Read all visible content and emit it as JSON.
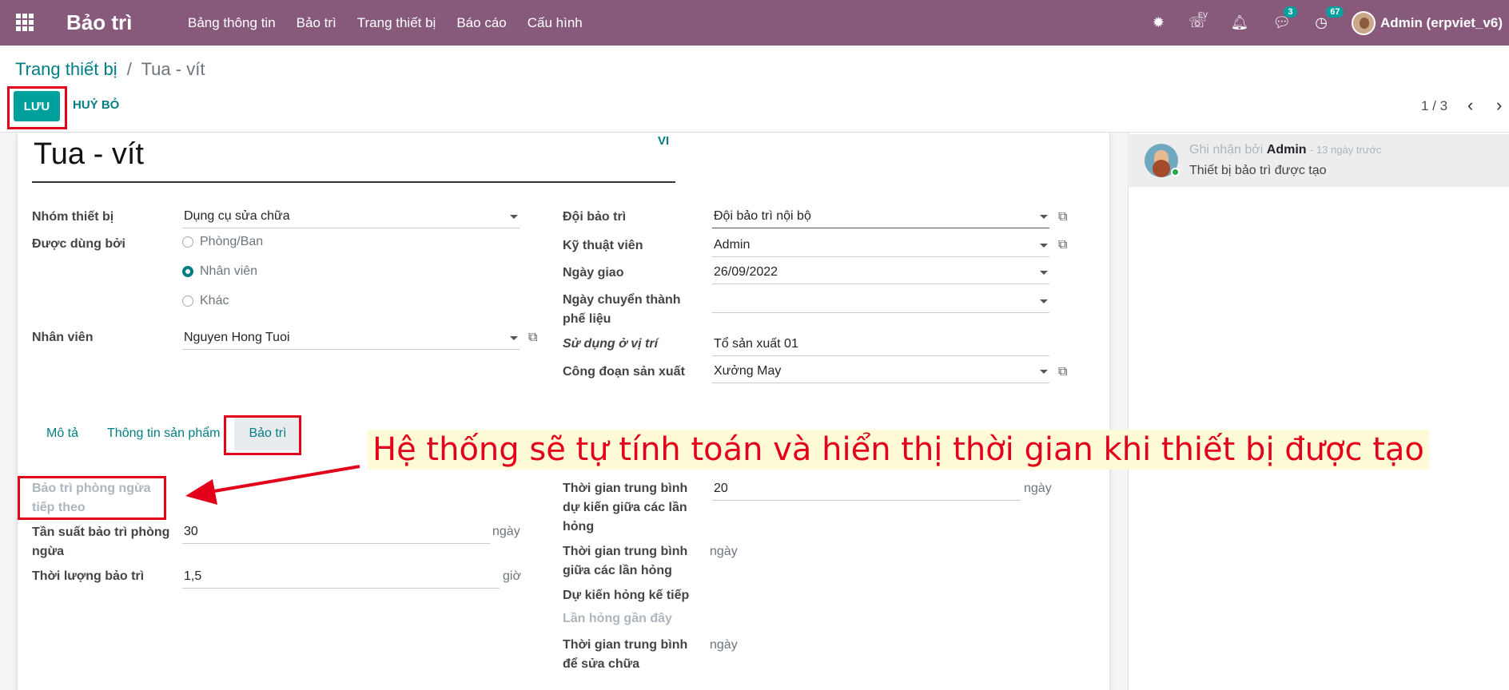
{
  "topbar": {
    "app_name": "Bảo trì",
    "menu": [
      "Bảng thông tin",
      "Bảo trì",
      "Trang thiết bị",
      "Báo cáo",
      "Cấu hình"
    ],
    "voip_label": "EV",
    "messages_count": "3",
    "activities_count": "67",
    "user": "Admin (erpviet_v6)",
    "bg_color": "#875a7b"
  },
  "control_panel": {
    "breadcrumb_parent": "Trang thiết bị",
    "breadcrumb_sep": "/",
    "breadcrumb_current": "Tua - vít",
    "save_label": "LƯU",
    "discard_label": "HUỶ BỎ",
    "pager": "1 / 3"
  },
  "form": {
    "name": "Tua - vít",
    "lang": "VI",
    "left": {
      "category_label": "Nhóm thiết bị",
      "category_value": "Dụng cụ sửa chữa",
      "used_by_label": "Được dùng bởi",
      "used_by_options": [
        "Phòng/Ban",
        "Nhân viên",
        "Khác"
      ],
      "used_by_selected": "Nhân viên",
      "employee_label": "Nhân viên",
      "employee_value": "Nguyen Hong Tuoi"
    },
    "right": {
      "team_label": "Đội bảo trì",
      "team_value": "Đội bảo trì nội bộ",
      "tech_label": "Kỹ thuật viên",
      "tech_value": "Admin",
      "assign_date_label": "Ngày giao",
      "assign_date_value": "26/09/2022",
      "scrap_date_label_1": "Ngày chuyển thành",
      "scrap_date_label_2": "phế liệu",
      "scrap_date_value": "",
      "location_label": "Sử dụng ở vị trí",
      "location_value": "Tổ sản xuất 01",
      "workcenter_label": "Công đoạn sản xuất",
      "workcenter_value": "Xưởng May"
    },
    "tabs": [
      "Mô tả",
      "Thông tin sản phẩm",
      "Bảo trì"
    ],
    "active_tab": "Bảo trì",
    "maintenance": {
      "next_pm_label_1": "Bảo trì phòng ngừa",
      "next_pm_label_2": "tiếp theo",
      "freq_label_1": "Tần suất bảo trì phòng",
      "freq_label_2": "ngừa",
      "freq_value": "30",
      "freq_unit": "ngày",
      "duration_label": "Thời lượng bảo trì",
      "duration_value": "1,5",
      "duration_unit": "giờ",
      "mtbf_expected_label_1": "Thời gian trung bình",
      "mtbf_expected_label_2": "dự kiến giữa các lần",
      "mtbf_expected_label_3": "hỏng",
      "mtbf_expected_value": "20",
      "mtbf_expected_unit": "ngày",
      "mtbf_label_1": "Thời gian trung bình",
      "mtbf_label_2": "giữa các lần hỏng",
      "mtbf_unit": "ngày",
      "next_failure_label": "Dự kiến hỏng kế tiếp",
      "last_failure_label": "Lần hỏng gần đây",
      "mttr_label_1": "Thời gian trung bình",
      "mttr_label_2": "để sửa chữa",
      "mttr_unit": "ngày"
    }
  },
  "chatter": {
    "prefix": "Ghi nhận bởi",
    "author": "Admin",
    "time": "- 13 ngày trước",
    "body": "Thiết bị bảo trì được tạo"
  },
  "annotation": {
    "text": "Hệ thống sẽ tự tính toán và hiển thị thời gian khi thiết bị được tạo"
  }
}
